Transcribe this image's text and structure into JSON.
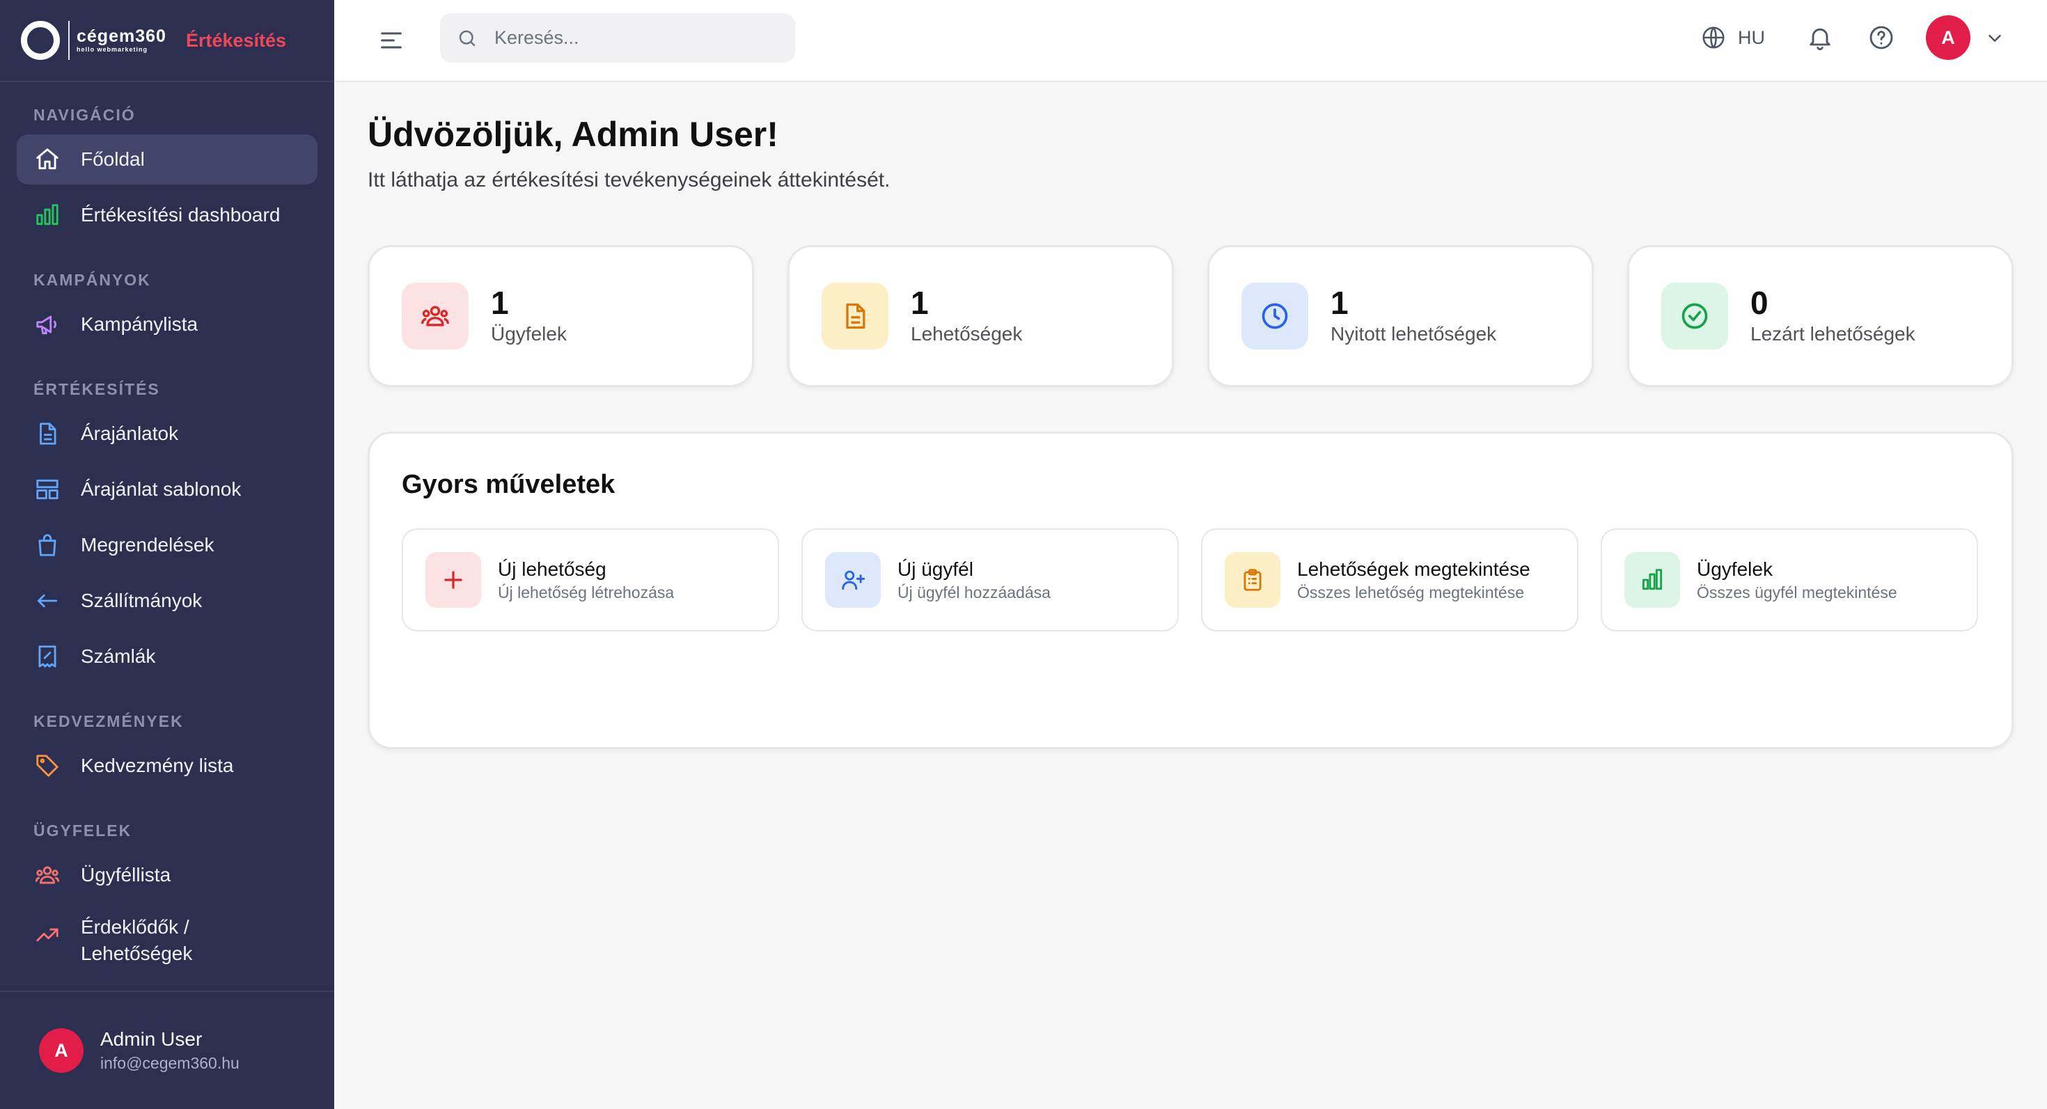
{
  "brand": {
    "name": "cégem360",
    "tagline": "hello webmarketing",
    "app_title": "Értékesítés"
  },
  "sidebar": {
    "sections": [
      {
        "title": "NAVIGÁCIÓ",
        "items": [
          {
            "label": "Főoldal",
            "icon": "home-icon",
            "active": true,
            "color": "#ffffff"
          },
          {
            "label": "Értékesítési dashboard",
            "icon": "bar-chart-icon",
            "color": "#22c55e"
          }
        ]
      },
      {
        "title": "KAMPÁNYOK",
        "items": [
          {
            "label": "Kampánylista",
            "icon": "megaphone-icon",
            "color": "#c084fc"
          }
        ]
      },
      {
        "title": "ÉRTÉKESÍTÉS",
        "items": [
          {
            "label": "Árajánlatok",
            "icon": "document-icon",
            "color": "#60a5fa"
          },
          {
            "label": "Árajánlat sablonok",
            "icon": "template-icon",
            "color": "#60a5fa"
          },
          {
            "label": "Megrendelések",
            "icon": "shopping-bag-icon",
            "color": "#60a5fa"
          },
          {
            "label": "Szállítmányok",
            "icon": "arrow-left-icon",
            "color": "#60a5fa"
          },
          {
            "label": "Számlák",
            "icon": "receipt-icon",
            "color": "#60a5fa"
          }
        ]
      },
      {
        "title": "KEDVEZMÉNYEK",
        "items": [
          {
            "label": "Kedvezmény lista",
            "icon": "tag-icon",
            "color": "#fb923c"
          }
        ]
      },
      {
        "title": "ÜGYFELEK",
        "items": [
          {
            "label": "Ügyféllista",
            "icon": "users-icon",
            "color": "#f87171"
          },
          {
            "label": "Érdeklődők / Lehetőségek",
            "icon": "trending-up-icon",
            "color": "#f87171"
          }
        ]
      }
    ]
  },
  "user": {
    "name": "Admin User",
    "email": "info@cegem360.hu",
    "initial": "A"
  },
  "topbar": {
    "search_placeholder": "Keresés...",
    "language": "HU"
  },
  "main": {
    "welcome": "Üdvözöljük, Admin User!",
    "subtitle": "Itt láthatja az értékesítési tevékenységeinek áttekintését.",
    "stats": [
      {
        "value": "1",
        "label": "Ügyfelek",
        "icon": "users-icon",
        "bg": "#fde2e4",
        "fg": "#dc2626"
      },
      {
        "value": "1",
        "label": "Lehetőségek",
        "icon": "document-icon",
        "bg": "#fdefc5",
        "fg": "#d97706"
      },
      {
        "value": "1",
        "label": "Nyitott lehetőségek",
        "icon": "clock-icon",
        "bg": "#dde8fd",
        "fg": "#2563eb"
      },
      {
        "value": "0",
        "label": "Lezárt lehetőségek",
        "icon": "check-circle-icon",
        "bg": "#dcf5e6",
        "fg": "#16a34a"
      }
    ],
    "quick_actions": {
      "title": "Gyors műveletek",
      "items": [
        {
          "title": "Új lehetőség",
          "subtitle": "Új lehetőség létrehozása",
          "icon": "plus-icon",
          "bg": "#fde2e4",
          "fg": "#dc2626"
        },
        {
          "title": "Új ügyfél",
          "subtitle": "Új ügyfél hozzáadása",
          "icon": "user-plus-icon",
          "bg": "#dde8fd",
          "fg": "#2563eb"
        },
        {
          "title": "Lehetőségek megtekintése",
          "subtitle": "Összes lehetőség megtekintése",
          "icon": "clipboard-icon",
          "bg": "#fdefc5",
          "fg": "#d97706"
        },
        {
          "title": "Ügyfelek",
          "subtitle": "Összes ügyfél megtekintése",
          "icon": "bar-chart-icon",
          "bg": "#dcf5e6",
          "fg": "#16a34a"
        }
      ]
    }
  }
}
